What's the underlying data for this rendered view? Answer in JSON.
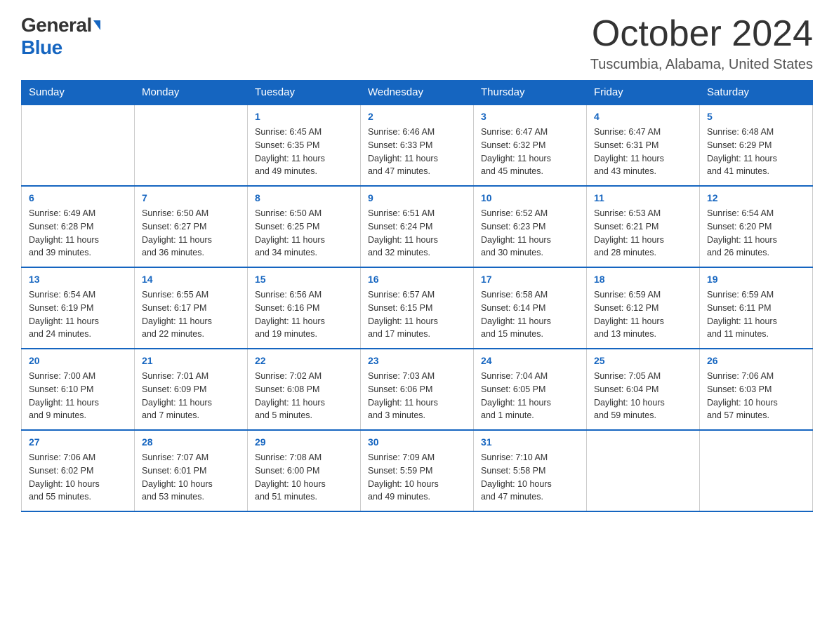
{
  "logo": {
    "general": "General",
    "blue": "Blue"
  },
  "title": "October 2024",
  "location": "Tuscumbia, Alabama, United States",
  "weekdays": [
    "Sunday",
    "Monday",
    "Tuesday",
    "Wednesday",
    "Thursday",
    "Friday",
    "Saturday"
  ],
  "weeks": [
    [
      {
        "day": "",
        "info": ""
      },
      {
        "day": "",
        "info": ""
      },
      {
        "day": "1",
        "info": "Sunrise: 6:45 AM\nSunset: 6:35 PM\nDaylight: 11 hours\nand 49 minutes."
      },
      {
        "day": "2",
        "info": "Sunrise: 6:46 AM\nSunset: 6:33 PM\nDaylight: 11 hours\nand 47 minutes."
      },
      {
        "day": "3",
        "info": "Sunrise: 6:47 AM\nSunset: 6:32 PM\nDaylight: 11 hours\nand 45 minutes."
      },
      {
        "day": "4",
        "info": "Sunrise: 6:47 AM\nSunset: 6:31 PM\nDaylight: 11 hours\nand 43 minutes."
      },
      {
        "day": "5",
        "info": "Sunrise: 6:48 AM\nSunset: 6:29 PM\nDaylight: 11 hours\nand 41 minutes."
      }
    ],
    [
      {
        "day": "6",
        "info": "Sunrise: 6:49 AM\nSunset: 6:28 PM\nDaylight: 11 hours\nand 39 minutes."
      },
      {
        "day": "7",
        "info": "Sunrise: 6:50 AM\nSunset: 6:27 PM\nDaylight: 11 hours\nand 36 minutes."
      },
      {
        "day": "8",
        "info": "Sunrise: 6:50 AM\nSunset: 6:25 PM\nDaylight: 11 hours\nand 34 minutes."
      },
      {
        "day": "9",
        "info": "Sunrise: 6:51 AM\nSunset: 6:24 PM\nDaylight: 11 hours\nand 32 minutes."
      },
      {
        "day": "10",
        "info": "Sunrise: 6:52 AM\nSunset: 6:23 PM\nDaylight: 11 hours\nand 30 minutes."
      },
      {
        "day": "11",
        "info": "Sunrise: 6:53 AM\nSunset: 6:21 PM\nDaylight: 11 hours\nand 28 minutes."
      },
      {
        "day": "12",
        "info": "Sunrise: 6:54 AM\nSunset: 6:20 PM\nDaylight: 11 hours\nand 26 minutes."
      }
    ],
    [
      {
        "day": "13",
        "info": "Sunrise: 6:54 AM\nSunset: 6:19 PM\nDaylight: 11 hours\nand 24 minutes."
      },
      {
        "day": "14",
        "info": "Sunrise: 6:55 AM\nSunset: 6:17 PM\nDaylight: 11 hours\nand 22 minutes."
      },
      {
        "day": "15",
        "info": "Sunrise: 6:56 AM\nSunset: 6:16 PM\nDaylight: 11 hours\nand 19 minutes."
      },
      {
        "day": "16",
        "info": "Sunrise: 6:57 AM\nSunset: 6:15 PM\nDaylight: 11 hours\nand 17 minutes."
      },
      {
        "day": "17",
        "info": "Sunrise: 6:58 AM\nSunset: 6:14 PM\nDaylight: 11 hours\nand 15 minutes."
      },
      {
        "day": "18",
        "info": "Sunrise: 6:59 AM\nSunset: 6:12 PM\nDaylight: 11 hours\nand 13 minutes."
      },
      {
        "day": "19",
        "info": "Sunrise: 6:59 AM\nSunset: 6:11 PM\nDaylight: 11 hours\nand 11 minutes."
      }
    ],
    [
      {
        "day": "20",
        "info": "Sunrise: 7:00 AM\nSunset: 6:10 PM\nDaylight: 11 hours\nand 9 minutes."
      },
      {
        "day": "21",
        "info": "Sunrise: 7:01 AM\nSunset: 6:09 PM\nDaylight: 11 hours\nand 7 minutes."
      },
      {
        "day": "22",
        "info": "Sunrise: 7:02 AM\nSunset: 6:08 PM\nDaylight: 11 hours\nand 5 minutes."
      },
      {
        "day": "23",
        "info": "Sunrise: 7:03 AM\nSunset: 6:06 PM\nDaylight: 11 hours\nand 3 minutes."
      },
      {
        "day": "24",
        "info": "Sunrise: 7:04 AM\nSunset: 6:05 PM\nDaylight: 11 hours\nand 1 minute."
      },
      {
        "day": "25",
        "info": "Sunrise: 7:05 AM\nSunset: 6:04 PM\nDaylight: 10 hours\nand 59 minutes."
      },
      {
        "day": "26",
        "info": "Sunrise: 7:06 AM\nSunset: 6:03 PM\nDaylight: 10 hours\nand 57 minutes."
      }
    ],
    [
      {
        "day": "27",
        "info": "Sunrise: 7:06 AM\nSunset: 6:02 PM\nDaylight: 10 hours\nand 55 minutes."
      },
      {
        "day": "28",
        "info": "Sunrise: 7:07 AM\nSunset: 6:01 PM\nDaylight: 10 hours\nand 53 minutes."
      },
      {
        "day": "29",
        "info": "Sunrise: 7:08 AM\nSunset: 6:00 PM\nDaylight: 10 hours\nand 51 minutes."
      },
      {
        "day": "30",
        "info": "Sunrise: 7:09 AM\nSunset: 5:59 PM\nDaylight: 10 hours\nand 49 minutes."
      },
      {
        "day": "31",
        "info": "Sunrise: 7:10 AM\nSunset: 5:58 PM\nDaylight: 10 hours\nand 47 minutes."
      },
      {
        "day": "",
        "info": ""
      },
      {
        "day": "",
        "info": ""
      }
    ]
  ]
}
